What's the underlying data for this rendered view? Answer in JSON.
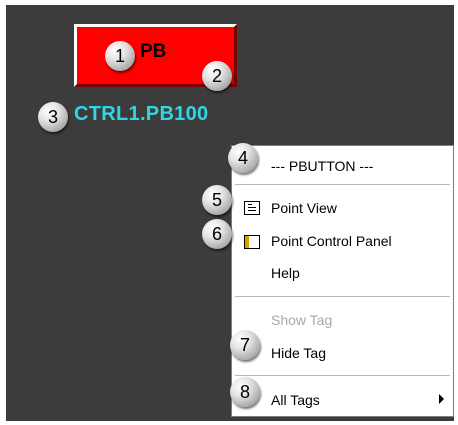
{
  "pushbutton": {
    "label": "PB",
    "color": "#ff0000"
  },
  "tag_name": "CTRL1.PB100",
  "tag_color": "#2fd6e6",
  "callouts": [
    "1",
    "2",
    "3",
    "4",
    "5",
    "6",
    "7",
    "8"
  ],
  "context_menu": {
    "title": "--- PBUTTON ---",
    "point_view": "Point View",
    "point_control_panel": "Point Control Panel",
    "help": "Help",
    "show_tag": "Show Tag",
    "hide_tag": "Hide Tag",
    "all_tags": "All Tags",
    "icons": {
      "point_view": "detail-list-icon",
      "point_control_panel": "control-panel-icon",
      "all_tags": "submenu-arrow-icon"
    }
  }
}
